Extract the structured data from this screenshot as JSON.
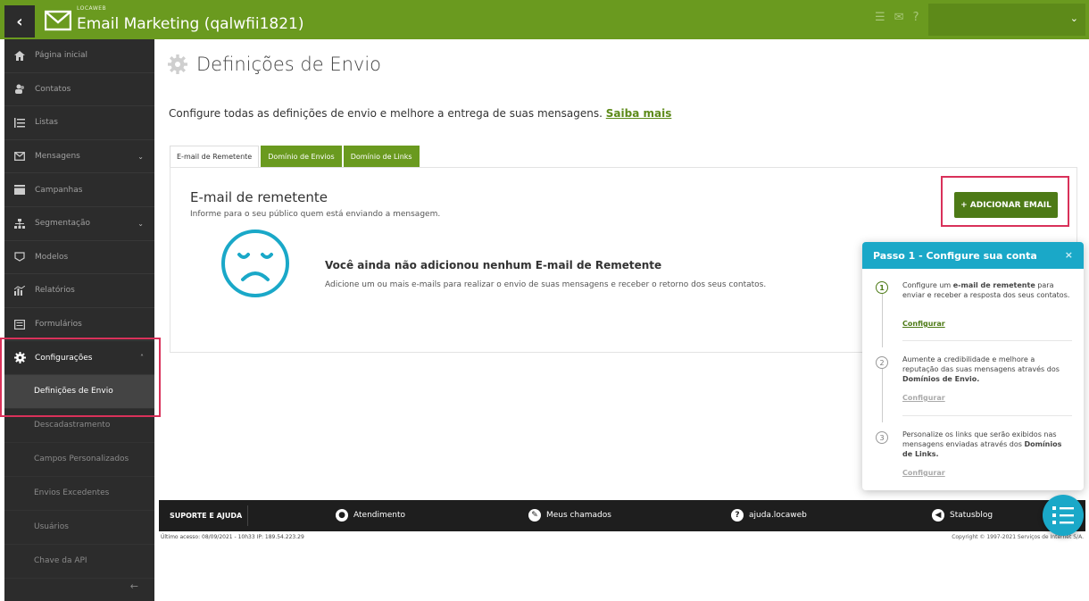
{
  "header": {
    "back_label": "‹",
    "brand_small": "LOCAWEB",
    "title": "Email Marketing (qalwfii1821)"
  },
  "sidebar": {
    "items": [
      {
        "label": "Página inicial",
        "icon": "home-icon"
      },
      {
        "label": "Contatos",
        "icon": "contacts-icon"
      },
      {
        "label": "Listas",
        "icon": "list-icon"
      },
      {
        "label": "Mensagens",
        "icon": "envelope-icon",
        "chevron": "⌄"
      },
      {
        "label": "Campanhas",
        "icon": "stack-icon"
      },
      {
        "label": "Segmentação",
        "icon": "hierarchy-icon",
        "chevron": "⌄"
      },
      {
        "label": "Modelos",
        "icon": "template-icon"
      },
      {
        "label": "Relatórios",
        "icon": "chart-icon"
      },
      {
        "label": "Formulários",
        "icon": "form-icon"
      },
      {
        "label": "Configurações",
        "icon": "gear-icon",
        "chevron": "˄"
      }
    ],
    "sub_items": [
      "Definições de Envio",
      "Descadastramento",
      "Campos Personalizados",
      "Envios Excedentes",
      "Usuários",
      "Chave da API"
    ],
    "collapse_label": "←"
  },
  "main": {
    "page_title": "Definições de Envio",
    "intro_text": "Configure todas as definições de envio e melhore a entrega de suas mensagens.",
    "intro_link": "Saiba mais",
    "tabs": [
      "E-mail de Remetente",
      "Domínio de Envios",
      "Domínio de Links"
    ],
    "panel_title": "E-mail de remetente",
    "panel_sub": "Informe para o seu público quem está enviando a mensagem.",
    "add_button": "+ ADICIONAR EMAIL",
    "empty_title": "Você ainda não adicionou nenhum E-mail de Remetente",
    "empty_desc": "Adicione um ou mais e-mails para realizar o envio de suas mensagens e receber o retorno dos seus contatos."
  },
  "footer": {
    "title": "SUPORTE E AJUDA",
    "links": [
      "Atendimento",
      "Meus chamados",
      "ajuda.locaweb",
      "Statusblog"
    ],
    "last_access": "Último acesso: 08/09/2021 - 10h33   IP: 189.54.223.29",
    "copyright": "Copyright © 1997-2021 Serviços de Internet S/A."
  },
  "guide": {
    "title": "Passo 1 - Configure sua conta",
    "close": "×",
    "steps": [
      {
        "num": "1",
        "pre": "Configure um ",
        "bold": "e-mail de remetente",
        "post": " para enviar e receber a resposta dos seus contatos.",
        "link": "Configurar"
      },
      {
        "num": "2",
        "pre": "Aumente a credibilidade e melhore a reputação das suas mensagens através dos ",
        "bold": "Domínios de Envio.",
        "post": "",
        "link": "Configurar"
      },
      {
        "num": "3",
        "pre": "Personalize os links que serão exibidos nas mensagens enviadas através dos ",
        "bold": "Domínios de Links.",
        "post": "",
        "link": "Configurar"
      }
    ]
  },
  "colors": {
    "brand_green": "#6a9a1f",
    "button_green": "#4d7a16",
    "sidebar_bg": "#2c2c2c",
    "guide_blue": "#1aa8c8",
    "highlight_red": "#d9315a"
  }
}
